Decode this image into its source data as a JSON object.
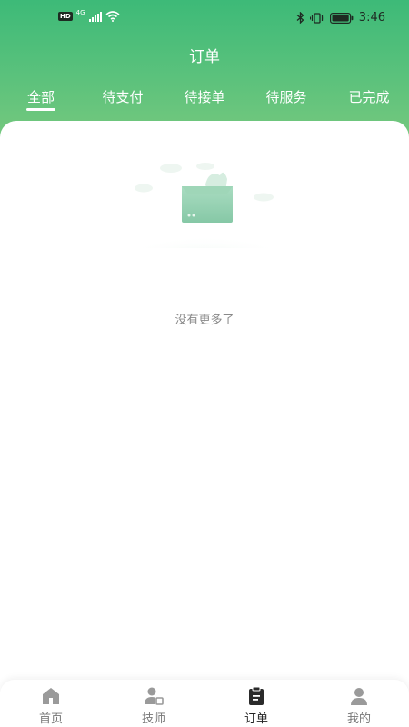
{
  "status_bar": {
    "left_badge": "HD",
    "network": "4G",
    "time": "3:46"
  },
  "header": {
    "title": "订单"
  },
  "tabs": [
    {
      "label": "全部",
      "active": true
    },
    {
      "label": "待支付",
      "active": false
    },
    {
      "label": "待接单",
      "active": false
    },
    {
      "label": "待服务",
      "active": false
    },
    {
      "label": "已完成",
      "active": false
    }
  ],
  "empty_state": {
    "message": "没有更多了"
  },
  "bottom_nav": [
    {
      "label": "首页",
      "icon": "home-icon",
      "active": false
    },
    {
      "label": "技师",
      "icon": "technician-icon",
      "active": false
    },
    {
      "label": "订单",
      "icon": "clipboard-icon",
      "active": true
    },
    {
      "label": "我的",
      "icon": "user-icon",
      "active": false
    }
  ],
  "colors": {
    "header_top": "#3dba78",
    "header_bottom": "#78c97e",
    "illustration_green": "#8fcfae",
    "nav_active": "#222222",
    "nav_inactive": "#777777"
  }
}
